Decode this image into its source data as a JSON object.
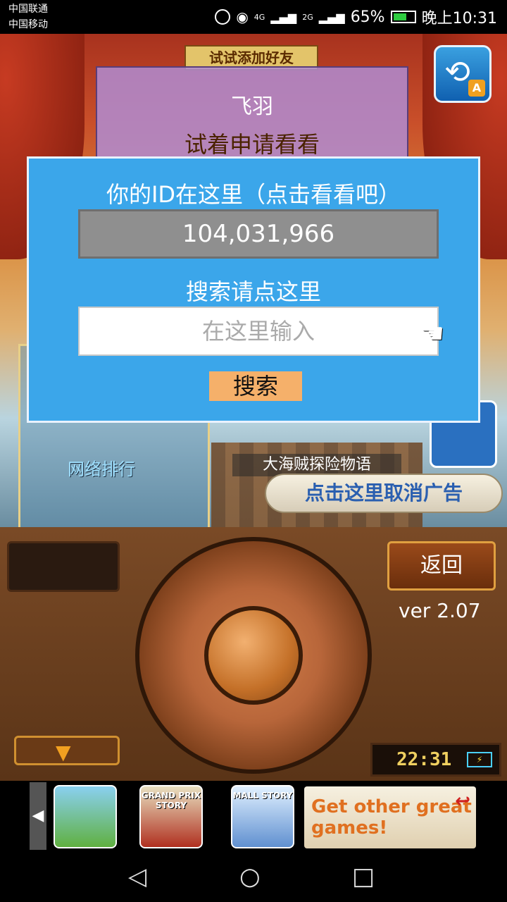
{
  "status_bar": {
    "carrier_1": "中国联通",
    "carrier_2": "中国移动",
    "network_1": "4G",
    "network_2": "2G",
    "battery": "65%",
    "time": "晚上10:31"
  },
  "scene": {
    "banner": "试试添加好友",
    "friend_name": "飞羽",
    "friend_hint": "试着申请看看",
    "ranking_label": "网络排行",
    "story_label": "大海贼探险物语",
    "cancel_ad": "点击这里取消广告",
    "sync_badge": "A"
  },
  "dialog": {
    "id_prompt": "你的ID在这里（点击看看吧）",
    "id_value": "104,031,966",
    "search_prompt": "搜索请点这里",
    "search_placeholder": "在这里输入",
    "search_button": "搜索"
  },
  "console": {
    "back_button": "返回",
    "version": "ver 2.07",
    "clock": "22:31"
  },
  "ads": {
    "tile_2": "GRAND PRIX STORY",
    "tile_3": "MALL STORY",
    "more_games": "Get other great games!"
  },
  "colors": {
    "dialog_bg": "#3ba6ea",
    "search_button": "#f5b06a",
    "id_box": "#8f8f8f"
  }
}
